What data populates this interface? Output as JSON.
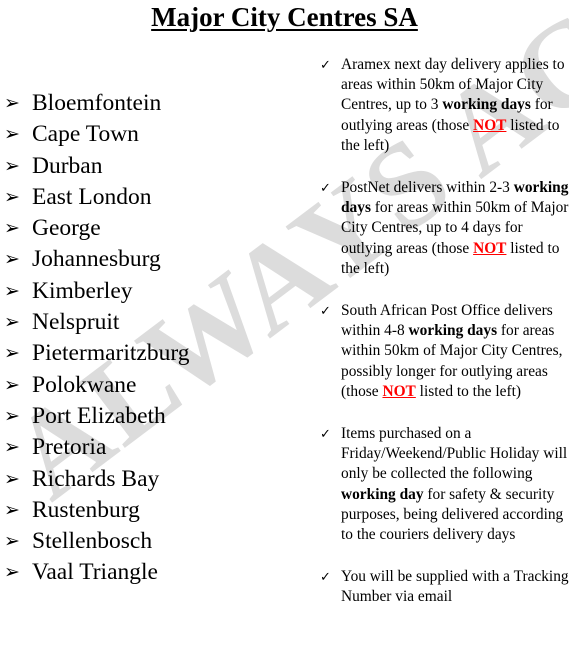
{
  "document": {
    "title": "Major City Centres SA",
    "watermark_text": "ALWAYS ACES",
    "watermark_color": "#dcdcdc",
    "accent_color": "#ff0000",
    "background_color": "#ffffff",
    "text_color": "#000000"
  },
  "city_list": {
    "bullet_glyph": "➢",
    "bullet_icon_name": "arrow-bullet-icon",
    "items": [
      {
        "label": "Bloemfontein"
      },
      {
        "label": "Cape Town"
      },
      {
        "label": "Durban"
      },
      {
        "label": "East London"
      },
      {
        "label": "George"
      },
      {
        "label": "Johannesburg"
      },
      {
        "label": "Kimberley"
      },
      {
        "label": "Nelspruit"
      },
      {
        "label": "Pietermaritzburg"
      },
      {
        "label": "Polokwane"
      },
      {
        "label": "Port Elizabeth"
      },
      {
        "label": "Pretoria"
      },
      {
        "label": "Richards Bay"
      },
      {
        "label": "Rustenburg"
      },
      {
        "label": "Stellenbosch"
      },
      {
        "label": "Vaal Triangle"
      }
    ]
  },
  "notes_list": {
    "bullet_glyph": "✓",
    "bullet_icon_name": "check-bullet-icon",
    "items": [
      {
        "id": "aramex",
        "segments": [
          {
            "text": "Aramex next day delivery applies to areas within 50km of Major City Centres, up to 3 ",
            "style": "normal"
          },
          {
            "text": "working days",
            "style": "bold"
          },
          {
            "text": " for outlying areas (those ",
            "style": "normal"
          },
          {
            "text": "NOT",
            "style": "red-bold-underline"
          },
          {
            "text": " listed to the left)",
            "style": "normal"
          }
        ]
      },
      {
        "id": "postnet",
        "segments": [
          {
            "text": "PostNet delivers within 2-3 ",
            "style": "normal"
          },
          {
            "text": "working days",
            "style": "bold"
          },
          {
            "text": " for areas within 50km of Major City Centres, up to 4 days for outlying areas (those ",
            "style": "normal"
          },
          {
            "text": "NOT",
            "style": "red-bold-underline"
          },
          {
            "text": " listed to the left)",
            "style": "normal"
          }
        ]
      },
      {
        "id": "sapo",
        "segments": [
          {
            "text": "South African Post Office delivers within 4-8 ",
            "style": "normal"
          },
          {
            "text": "working days",
            "style": "bold"
          },
          {
            "text": " for areas within 50km of Major City Centres, possibly longer for outlying areas (those ",
            "style": "normal"
          },
          {
            "text": "NOT",
            "style": "red-bold-underline"
          },
          {
            "text": " listed to the left)",
            "style": "normal"
          }
        ]
      },
      {
        "id": "weekend-collection",
        "segments": [
          {
            "text": "Items purchased  on a Friday/Weekend/Public Holiday will only be collected the following ",
            "style": "normal"
          },
          {
            "text": "working day",
            "style": "bold"
          },
          {
            "text": " for safety & security purposes, being delivered according to the couriers delivery days",
            "style": "normal"
          }
        ]
      },
      {
        "id": "tracking",
        "segments": [
          {
            "text": "You will be supplied with a Tracking Number via email",
            "style": "normal"
          }
        ]
      }
    ]
  }
}
